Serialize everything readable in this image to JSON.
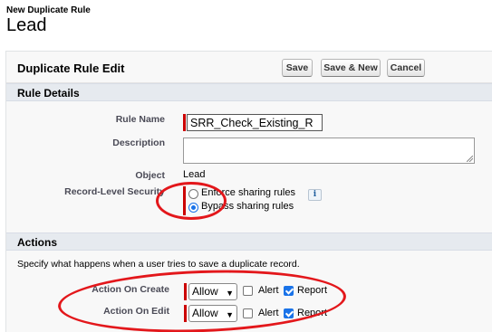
{
  "page": {
    "subtitle": "New Duplicate Rule",
    "title": "Lead"
  },
  "panel": {
    "title": "Duplicate Rule Edit",
    "buttons": {
      "save": "Save",
      "save_new": "Save & New",
      "cancel": "Cancel"
    }
  },
  "rule_details": {
    "section_title": "Rule Details",
    "rule_name": {
      "label": "Rule Name",
      "value": "SRR_Check_Existing_R"
    },
    "description": {
      "label": "Description",
      "value": ""
    },
    "object": {
      "label": "Object",
      "value": "Lead"
    },
    "record_level_security": {
      "label": "Record-Level Security",
      "options": [
        "Enforce sharing rules",
        "Bypass sharing rules"
      ],
      "selected": "Bypass sharing rules",
      "info_icon": "i"
    }
  },
  "actions": {
    "section_title": "Actions",
    "instructions": "Specify what happens when a user tries to save a duplicate record.",
    "on_create": {
      "label": "Action On Create",
      "action": "Allow",
      "alert_label": "Alert",
      "alert_checked": false,
      "report_label": "Report",
      "report_checked": true
    },
    "on_edit": {
      "label": "Action On Edit",
      "action": "Allow",
      "alert_label": "Alert",
      "alert_checked": false,
      "report_label": "Report",
      "report_checked": true
    }
  },
  "colors": {
    "required_bar": "#cc0000",
    "annotation": "#e3171b",
    "accent": "#1a73e8",
    "section_bg": "#e6eaef"
  },
  "icons": [
    "info-icon",
    "chevron-down-icon",
    "resize-grip-icon"
  ]
}
